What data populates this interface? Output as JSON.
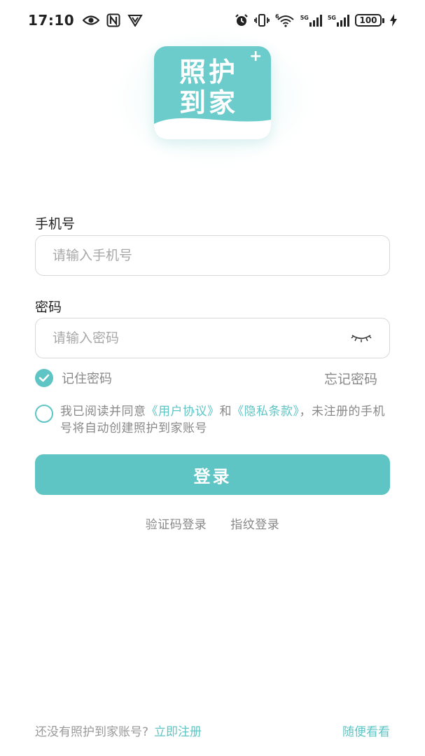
{
  "status_bar": {
    "time": "17:10",
    "left_icons": [
      "eye-icon",
      "nfc-icon",
      "shield-v-icon"
    ],
    "right_icons": [
      "alarm-icon",
      "vibrate-icon",
      "wifi-icon",
      "signal-5g-icon",
      "signal-5g-icon"
    ],
    "network_1": "5G",
    "network_2": "5G",
    "battery": "100"
  },
  "logo": {
    "line1": "照护",
    "line2": "到家",
    "plus": "+",
    "bg_color": "#6ccbcb"
  },
  "form": {
    "phone_label": "手机号",
    "phone_placeholder": "请输入手机号",
    "phone_value": "",
    "password_label": "密码",
    "password_placeholder": "请输入密码",
    "password_value": "",
    "eye_icon": "eye-closed-icon"
  },
  "remember": {
    "label": "记住密码",
    "checked": true,
    "forgot": "忘记密码"
  },
  "agreement": {
    "checked": false,
    "prefix": "我已阅读并同意",
    "user_agreement": "《用户协议》",
    "conjunction": "和",
    "privacy": "《隐私条款》",
    "suffix": "，未注册的手机号将自动创建照护到家账号"
  },
  "login_button": "登录",
  "alt_login": {
    "sms": "验证码登录",
    "fingerprint": "指纹登录"
  },
  "footer": {
    "no_account": "还没有照护到家账号?",
    "register": "立即注册",
    "browse": "随便看看"
  },
  "colors": {
    "accent": "#5fc4c4",
    "muted_text": "#888888",
    "border": "#d8d8d8"
  }
}
